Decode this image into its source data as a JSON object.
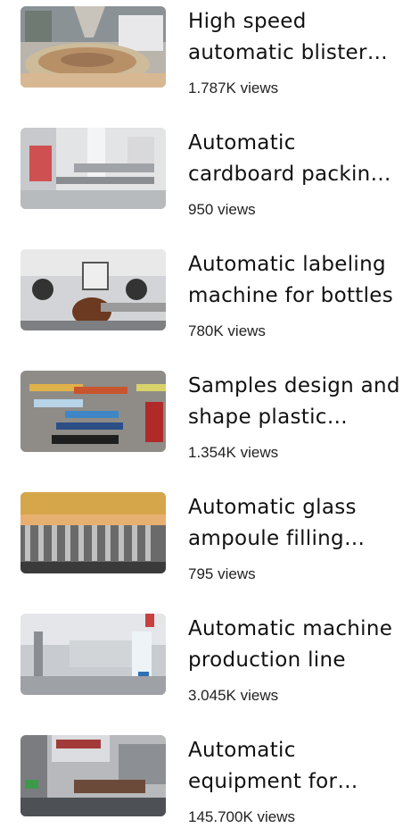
{
  "videos": [
    {
      "title": "High speed automatic blister packing machine",
      "views": "1.787K views",
      "thumbnail": "blister-machine-thumbnail"
    },
    {
      "title": "Automatic cardboard packing machine",
      "views": "950 views",
      "thumbnail": "cardboard-machine-thumbnail"
    },
    {
      "title": "Automatic labeling machine for bottles",
      "views": "780K views",
      "thumbnail": "labeling-machine-thumbnail"
    },
    {
      "title": "Samples design and shape plastic packaging",
      "views": "1.354K views",
      "thumbnail": "samples-packaging-thumbnail"
    },
    {
      "title": "Automatic glass ampoule filling machine",
      "views": "795 views",
      "thumbnail": "ampoule-filling-thumbnail"
    },
    {
      "title": "Automatic machine production line",
      "views": "3.045K views",
      "thumbnail": "production-line-thumbnail"
    },
    {
      "title": "Automatic equipment for packaging",
      "views": "145.700K views",
      "thumbnail": "packaging-equipment-thumbnail"
    }
  ]
}
